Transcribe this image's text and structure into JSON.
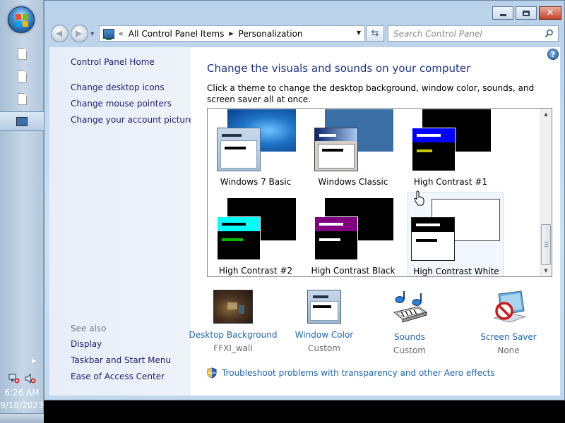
{
  "window": {
    "address": {
      "chevron": "«",
      "crumbs": [
        "All Control Panel Items",
        "Personalization"
      ]
    },
    "search_placeholder": "Search Control Panel",
    "caption": {
      "minimize": "minimize",
      "maximize": "maximize",
      "close": "✕"
    }
  },
  "left_pane": {
    "home_link": "Control Panel Home",
    "tasks": [
      "Change desktop icons",
      "Change mouse pointers",
      "Change your account picture"
    ],
    "see_also_label": "See also",
    "see_also": [
      "Display",
      "Taskbar and Start Menu",
      "Ease of Access Center"
    ]
  },
  "main": {
    "title": "Change the visuals and sounds on your computer",
    "description": "Click a theme to change the desktop background, window color, sounds, and screen saver all at once.",
    "themes": [
      {
        "name": "Windows 7 Basic"
      },
      {
        "name": "Windows Classic"
      },
      {
        "name": "High Contrast #1"
      },
      {
        "name": "High Contrast #2"
      },
      {
        "name": "High Contrast Black"
      },
      {
        "name": "High Contrast White",
        "selected": true
      }
    ],
    "settings": [
      {
        "label": "Desktop Background",
        "value": "FFXI_wall",
        "icon": "desktop-background-icon"
      },
      {
        "label": "Window Color",
        "value": "Custom",
        "icon": "window-color-icon"
      },
      {
        "label": "Sounds",
        "value": "Custom",
        "icon": "sounds-icon"
      },
      {
        "label": "Screen Saver",
        "value": "None",
        "icon": "screen-saver-icon"
      }
    ],
    "troubleshoot_link": "Troubleshoot problems with transparency and other Aero effects"
  },
  "taskbar": {
    "time": "6:26 AM",
    "date": "9/18/2023"
  },
  "colors": {
    "link": "#1e64b4",
    "title": "#1e3287",
    "contrast_cyan": "#00ffff",
    "contrast_green": "#00c000",
    "contrast_purple": "#800080",
    "contrast_blue": "#0000ff",
    "contrast_yellow": "#c8c800"
  }
}
